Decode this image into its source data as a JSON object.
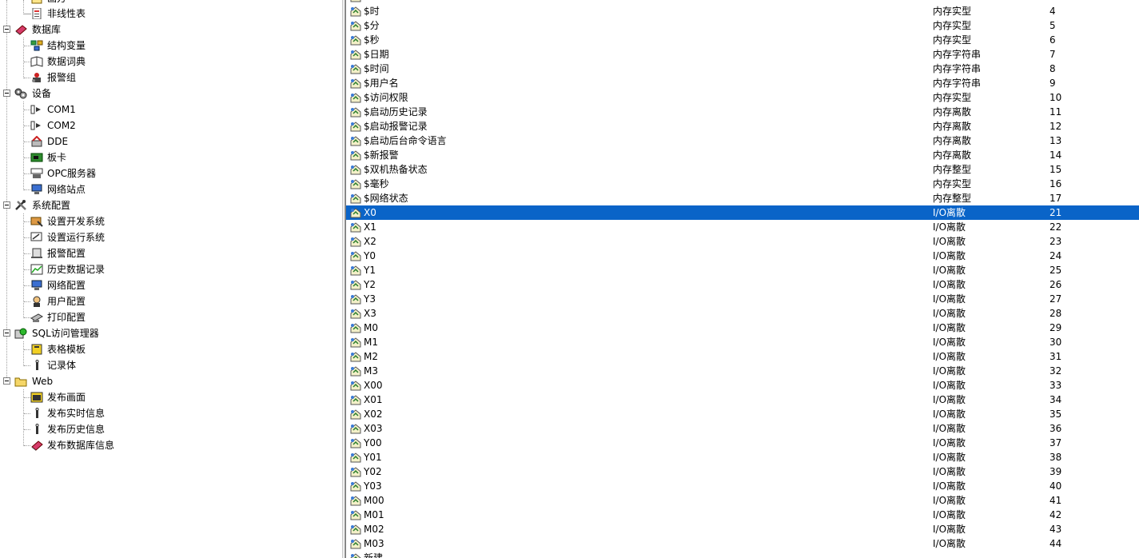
{
  "tree": {
    "items": [
      {
        "label": "画方",
        "icon": "picture-icon"
      },
      {
        "label": "非线性表",
        "icon": "table-doc-icon"
      },
      {
        "label": "数据库",
        "icon": "database-icon"
      },
      {
        "label": "结构变量",
        "icon": "struct-var-icon"
      },
      {
        "label": "数据词典",
        "icon": "data-dictionary-icon"
      },
      {
        "label": "报警组",
        "icon": "alarm-group-icon"
      },
      {
        "label": "设备",
        "icon": "device-icon"
      },
      {
        "label": "COM1",
        "icon": "com-port-icon"
      },
      {
        "label": "COM2",
        "icon": "com-port-icon"
      },
      {
        "label": "DDE",
        "icon": "dde-icon"
      },
      {
        "label": "板卡",
        "icon": "board-card-icon"
      },
      {
        "label": "OPC服务器",
        "icon": "opc-server-icon"
      },
      {
        "label": "网络站点",
        "icon": "network-station-icon"
      },
      {
        "label": "系统配置",
        "icon": "tools-icon"
      },
      {
        "label": "设置开发系统",
        "icon": "dev-system-icon"
      },
      {
        "label": "设置运行系统",
        "icon": "run-system-icon"
      },
      {
        "label": "报警配置",
        "icon": "alarm-config-icon"
      },
      {
        "label": "历史数据记录",
        "icon": "history-record-icon"
      },
      {
        "label": "网络配置",
        "icon": "network-config-icon"
      },
      {
        "label": "用户配置",
        "icon": "user-config-icon"
      },
      {
        "label": "打印配置",
        "icon": "printer-icon"
      },
      {
        "label": "SQL访问管理器",
        "icon": "sql-manager-icon"
      },
      {
        "label": "表格模板",
        "icon": "table-template-icon"
      },
      {
        "label": "记录体",
        "icon": "record-icon"
      },
      {
        "label": "Web",
        "icon": "folder-icon"
      },
      {
        "label": "发布画面",
        "icon": "publish-screen-icon"
      },
      {
        "label": "发布实时信息",
        "icon": "publish-realtime-icon"
      },
      {
        "label": "发布历史信息",
        "icon": "publish-history-icon"
      },
      {
        "label": "发布数据库信息",
        "icon": "publish-database-icon"
      }
    ]
  },
  "variables": {
    "rows": [
      {
        "name": "",
        "type": "",
        "id": ""
      },
      {
        "name": "$时",
        "type": "内存实型",
        "id": "4"
      },
      {
        "name": "$分",
        "type": "内存实型",
        "id": "5"
      },
      {
        "name": "$秒",
        "type": "内存实型",
        "id": "6"
      },
      {
        "name": "$日期",
        "type": "内存字符串",
        "id": "7"
      },
      {
        "name": "$时间",
        "type": "内存字符串",
        "id": "8"
      },
      {
        "name": "$用户名",
        "type": "内存字符串",
        "id": "9"
      },
      {
        "name": "$访问权限",
        "type": "内存实型",
        "id": "10"
      },
      {
        "name": "$启动历史记录",
        "type": "内存离散",
        "id": "11"
      },
      {
        "name": "$启动报警记录",
        "type": "内存离散",
        "id": "12"
      },
      {
        "name": "$启动后台命令语言",
        "type": "内存离散",
        "id": "13"
      },
      {
        "name": "$新报警",
        "type": "内存离散",
        "id": "14"
      },
      {
        "name": "$双机热备状态",
        "type": "内存整型",
        "id": "15"
      },
      {
        "name": "$毫秒",
        "type": "内存实型",
        "id": "16"
      },
      {
        "name": "$网络状态",
        "type": "内存整型",
        "id": "17"
      },
      {
        "name": "X0",
        "type": "I/O离散",
        "id": "21",
        "selected": true
      },
      {
        "name": "X1",
        "type": "I/O离散",
        "id": "22"
      },
      {
        "name": "X2",
        "type": "I/O离散",
        "id": "23"
      },
      {
        "name": "Y0",
        "type": "I/O离散",
        "id": "24"
      },
      {
        "name": "Y1",
        "type": "I/O离散",
        "id": "25"
      },
      {
        "name": "Y2",
        "type": "I/O离散",
        "id": "26"
      },
      {
        "name": "Y3",
        "type": "I/O离散",
        "id": "27"
      },
      {
        "name": "X3",
        "type": "I/O离散",
        "id": "28"
      },
      {
        "name": "M0",
        "type": "I/O离散",
        "id": "29"
      },
      {
        "name": "M1",
        "type": "I/O离散",
        "id": "30"
      },
      {
        "name": "M2",
        "type": "I/O离散",
        "id": "31"
      },
      {
        "name": "M3",
        "type": "I/O离散",
        "id": "32"
      },
      {
        "name": "X00",
        "type": "I/O离散",
        "id": "33"
      },
      {
        "name": "X01",
        "type": "I/O离散",
        "id": "34"
      },
      {
        "name": "X02",
        "type": "I/O离散",
        "id": "35"
      },
      {
        "name": "X03",
        "type": "I/O离散",
        "id": "36"
      },
      {
        "name": "Y00",
        "type": "I/O离散",
        "id": "37"
      },
      {
        "name": "Y01",
        "type": "I/O离散",
        "id": "38"
      },
      {
        "name": "Y02",
        "type": "I/O离散",
        "id": "39"
      },
      {
        "name": "Y03",
        "type": "I/O离散",
        "id": "40"
      },
      {
        "name": "M00",
        "type": "I/O离散",
        "id": "41"
      },
      {
        "name": "M01",
        "type": "I/O离散",
        "id": "42"
      },
      {
        "name": "M02",
        "type": "I/O离散",
        "id": "43"
      },
      {
        "name": "M03",
        "type": "I/O离散",
        "id": "44"
      },
      {
        "name": "新建...",
        "type": "",
        "id": ""
      }
    ]
  },
  "colors": {
    "selection": "#0a64c8",
    "tree_lines": "#a0a0a0"
  }
}
